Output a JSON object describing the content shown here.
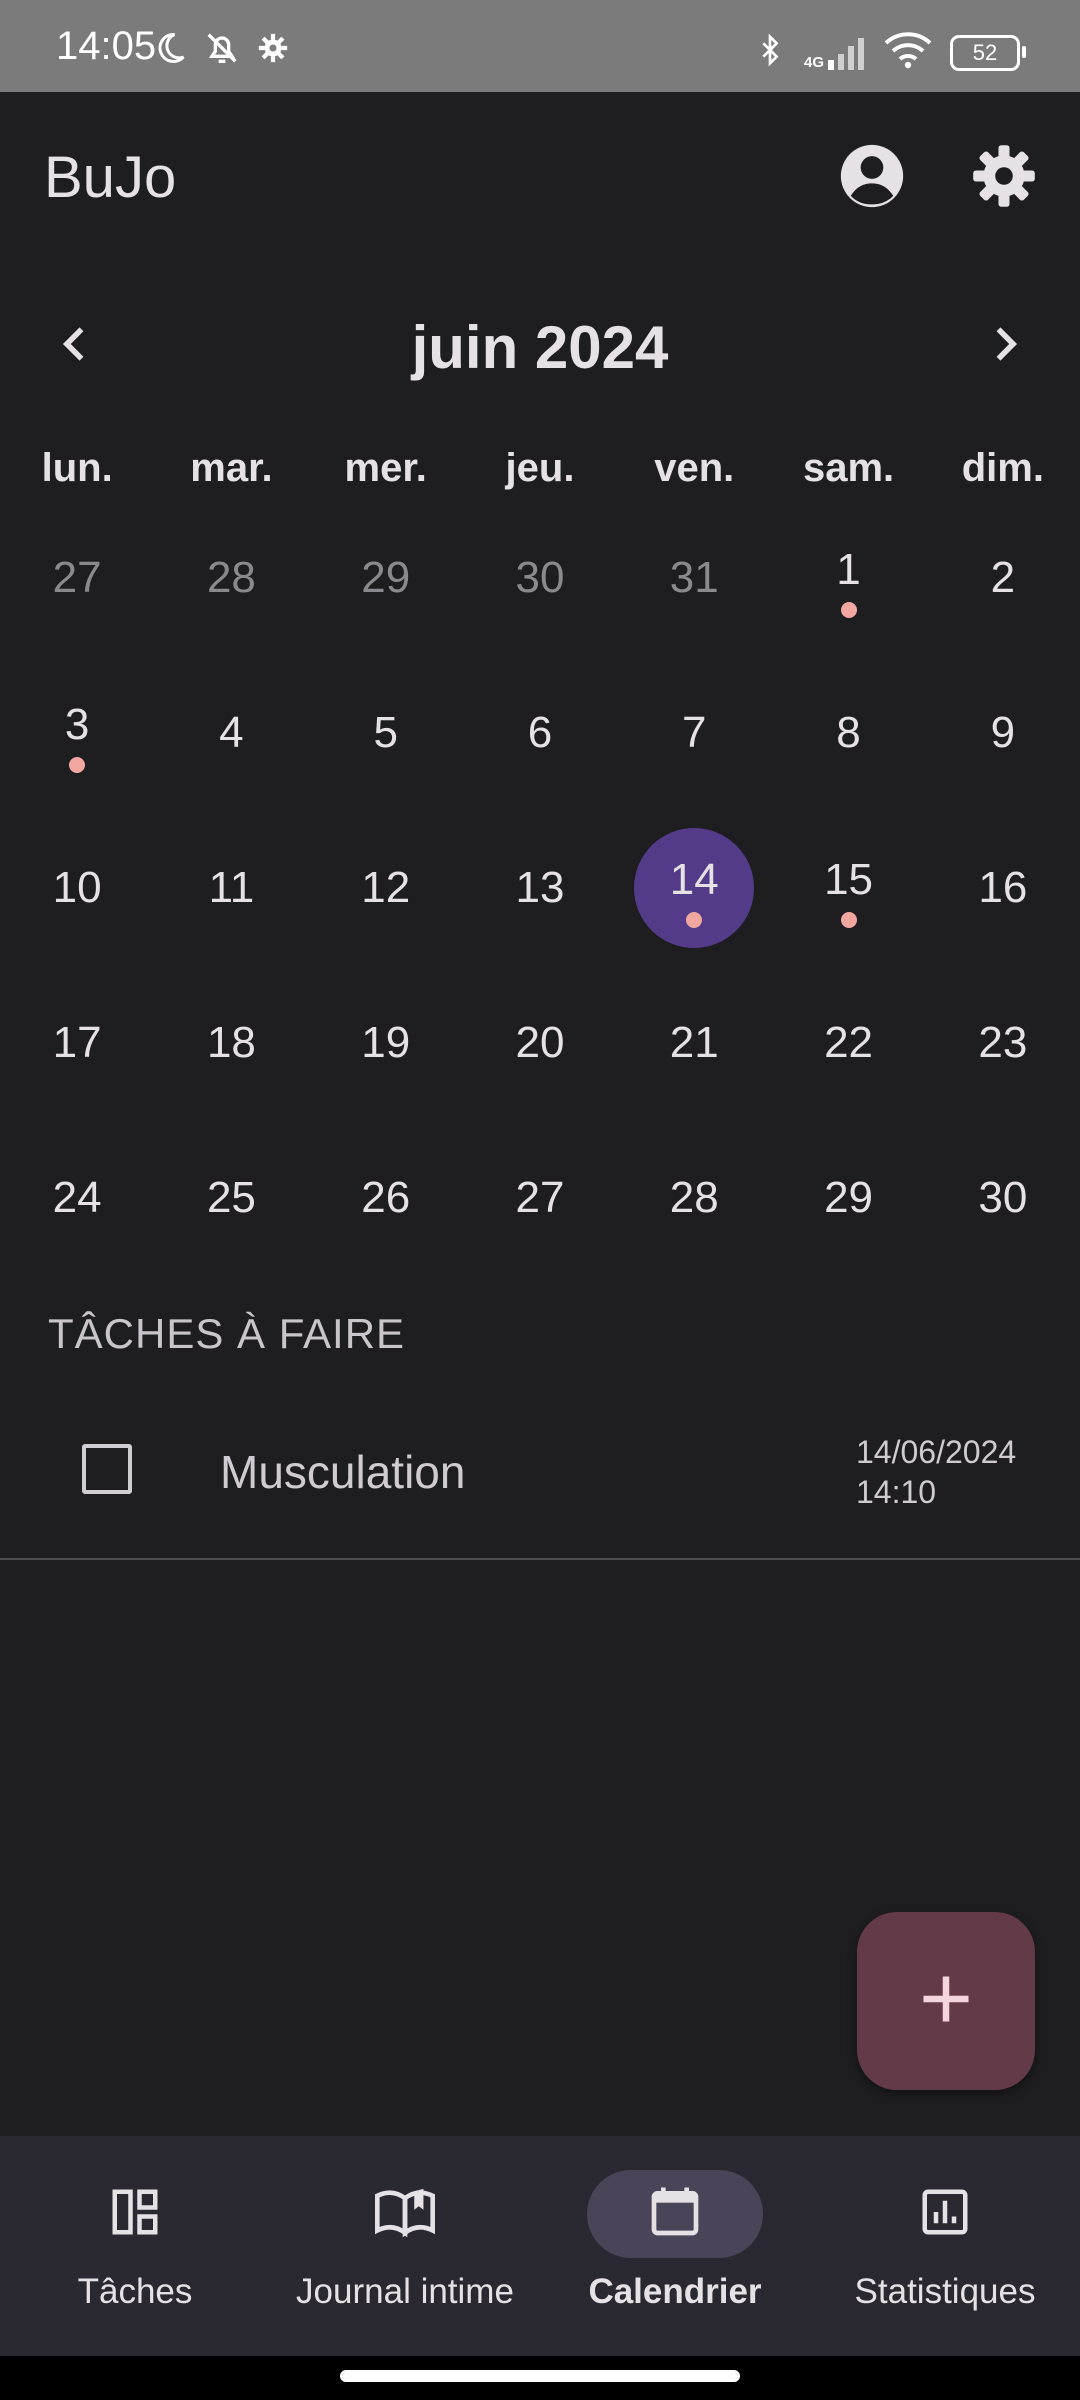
{
  "status_bar": {
    "time": "14:05",
    "battery": "52",
    "network": "4G",
    "icons": [
      "moon-icon",
      "alarm-off-icon",
      "settings-gear-icon",
      "bluetooth-icon",
      "signal-icon",
      "wifi-icon",
      "battery-icon"
    ]
  },
  "app_bar": {
    "title": "BuJo",
    "icons": [
      "account-circle-icon",
      "settings-icon"
    ]
  },
  "calendar": {
    "month_label": "juin 2024",
    "weekdays": [
      "lun.",
      "mar.",
      "mer.",
      "jeu.",
      "ven.",
      "sam.",
      "dim."
    ],
    "weeks": [
      [
        {
          "d": "27",
          "muted": true
        },
        {
          "d": "28",
          "muted": true
        },
        {
          "d": "29",
          "muted": true
        },
        {
          "d": "30",
          "muted": true
        },
        {
          "d": "31",
          "muted": true
        },
        {
          "d": "1",
          "dot": true
        },
        {
          "d": "2"
        }
      ],
      [
        {
          "d": "3",
          "dot": true
        },
        {
          "d": "4"
        },
        {
          "d": "5"
        },
        {
          "d": "6"
        },
        {
          "d": "7"
        },
        {
          "d": "8"
        },
        {
          "d": "9"
        }
      ],
      [
        {
          "d": "10"
        },
        {
          "d": "11"
        },
        {
          "d": "12"
        },
        {
          "d": "13"
        },
        {
          "d": "14",
          "selected": true,
          "dot": true
        },
        {
          "d": "15",
          "dot": true
        },
        {
          "d": "16"
        }
      ],
      [
        {
          "d": "17"
        },
        {
          "d": "18"
        },
        {
          "d": "19"
        },
        {
          "d": "20"
        },
        {
          "d": "21"
        },
        {
          "d": "22"
        },
        {
          "d": "23"
        }
      ],
      [
        {
          "d": "24"
        },
        {
          "d": "25"
        },
        {
          "d": "26"
        },
        {
          "d": "27"
        },
        {
          "d": "28"
        },
        {
          "d": "29"
        },
        {
          "d": "30"
        }
      ]
    ],
    "colors": {
      "selected_bg": "#543b8a",
      "event_dot": "#f2a8a1"
    }
  },
  "tasks": {
    "section_title": "TÂCHES À FAIRE",
    "items": [
      {
        "label": "Musculation",
        "date": "14/06/2024",
        "time": "14:10",
        "checked": false
      }
    ]
  },
  "fab": {
    "icon": "plus-icon",
    "color": "#633b48"
  },
  "bottom_nav": {
    "items": [
      {
        "label": "Tâches",
        "icon": "dashboard-icon",
        "active": false
      },
      {
        "label": "Journal intime",
        "icon": "book-icon",
        "active": false
      },
      {
        "label": "Calendrier",
        "icon": "calendar-icon",
        "active": true
      },
      {
        "label": "Statistiques",
        "icon": "bar-chart-icon",
        "active": false
      }
    ]
  }
}
